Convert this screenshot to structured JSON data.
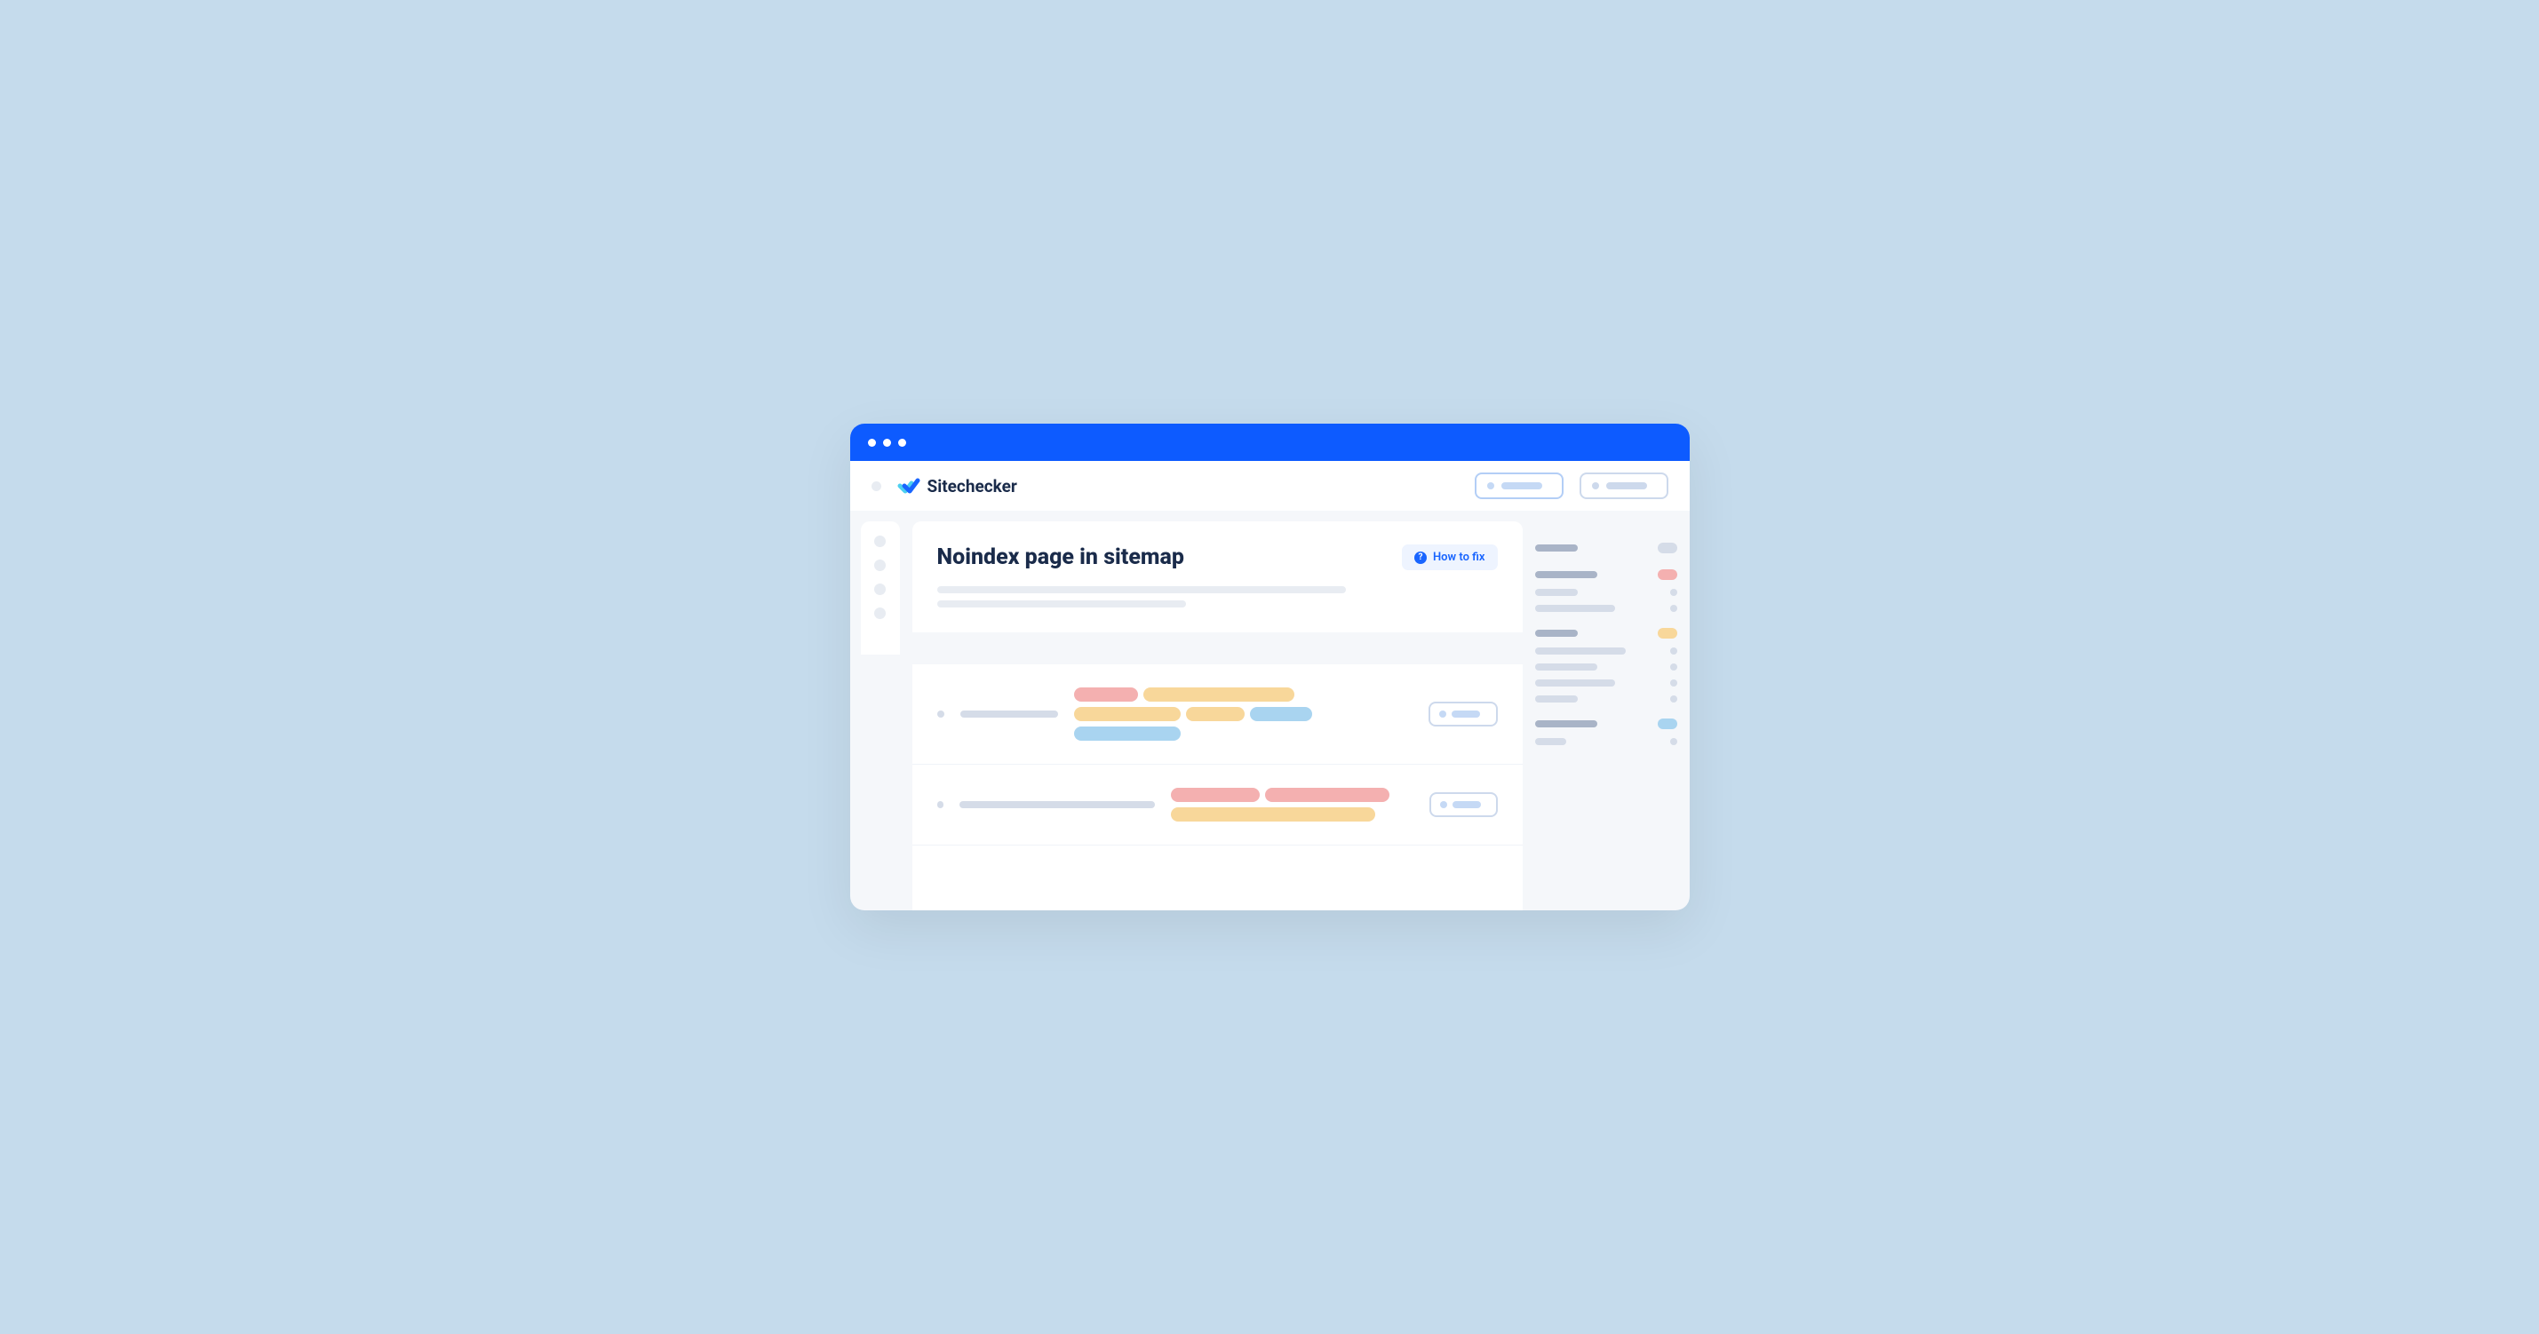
{
  "brand": {
    "name": "Sitechecker"
  },
  "page": {
    "title": "Noindex page in sitemap",
    "how_to_fix_label": "How to fix"
  },
  "colors": {
    "accent": "#0d5bff",
    "background": "#c5dbec",
    "text_dark": "#1a2b4a",
    "tag_red": "#f4b0b0",
    "tag_yellow": "#f8d79a",
    "tag_blue": "#a9d4f0"
  }
}
